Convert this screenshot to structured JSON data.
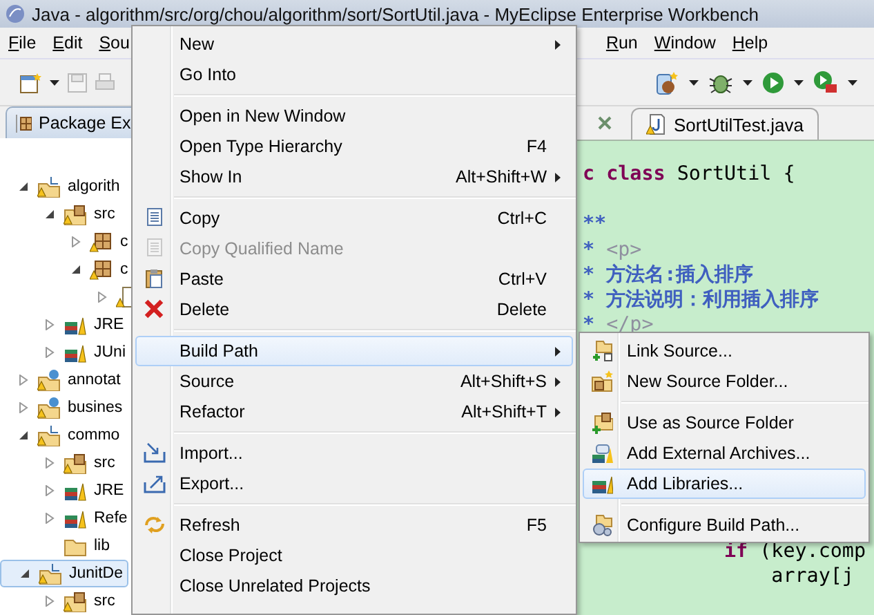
{
  "window": {
    "title": "Java - algorithm/src/org/chou/algorithm/sort/SortUtil.java - MyEclipse Enterprise Workbench"
  },
  "menubar": [
    "File",
    "Edit",
    "Sou",
    "Run",
    "Window",
    "Help"
  ],
  "explorer": {
    "title": "Package Ex",
    "tree": [
      {
        "label": "algorith",
        "kind": "project",
        "expanded": true,
        "selected": false,
        "children": [
          {
            "label": "src",
            "kind": "source-folder",
            "expanded": true,
            "selected": false,
            "children": [
              {
                "label": "c",
                "kind": "package",
                "expanded": false,
                "selected": false
              },
              {
                "label": "c",
                "kind": "package",
                "expanded": true,
                "selected": false,
                "children": [
                  {
                    "kind": "file",
                    "expanded": false,
                    "selected": false
                  }
                ]
              }
            ]
          },
          {
            "label": "JRE",
            "kind": "library",
            "expanded": false,
            "selected": false
          },
          {
            "label": "JUni",
            "kind": "library",
            "expanded": false,
            "selected": false
          }
        ]
      },
      {
        "label": "annotat",
        "kind": "web-project",
        "expanded": false,
        "selected": false
      },
      {
        "label": "busines",
        "kind": "web-project",
        "expanded": false,
        "selected": false
      },
      {
        "label": "commo",
        "kind": "project",
        "expanded": true,
        "selected": false,
        "children": [
          {
            "label": "src",
            "kind": "source-folder",
            "expanded": false,
            "selected": false
          },
          {
            "label": "JRE",
            "kind": "library",
            "expanded": false,
            "selected": false
          },
          {
            "label": "Refe",
            "kind": "library",
            "expanded": false,
            "selected": false
          },
          {
            "label": "lib",
            "kind": "folder",
            "selected": false
          }
        ]
      },
      {
        "label": "JunitDe",
        "kind": "project",
        "expanded": true,
        "selected": true,
        "children": [
          {
            "label": "src",
            "kind": "source-folder",
            "expanded": false,
            "selected": false
          }
        ]
      }
    ]
  },
  "editor": {
    "tabs": [
      {
        "label": "SortUtilTest.java",
        "selected": false
      }
    ],
    "lines": [
      [
        {
          "kind": "keyword",
          "text": "c class"
        },
        {
          "kind": "plain",
          "text": " SortUtil {"
        }
      ],
      [
        {
          "kind": "blank"
        }
      ],
      [
        {
          "kind": "javadoc",
          "text": "**"
        }
      ],
      [
        {
          "kind": "javadoc",
          "text": "* "
        },
        {
          "kind": "tag",
          "text": "<p>"
        }
      ],
      [
        {
          "kind": "javadoc",
          "text": "* 方法名:插入排序"
        }
      ],
      [
        {
          "kind": "javadoc",
          "text": "* 方法说明：利用插入排序"
        }
      ],
      [
        {
          "kind": "javadoc",
          "text": "* "
        },
        {
          "kind": "tag",
          "text": "</p>"
        }
      ],
      [
        {
          "kind": "blank"
        }
      ],
      [
        {
          "kind": "blank"
        }
      ],
      [
        {
          "kind": "blank"
        }
      ],
      [
        {
          "kind": "blank"
        }
      ],
      [
        {
          "kind": "blank"
        }
      ],
      [
        {
          "kind": "blank"
        }
      ],
      [
        {
          "kind": "blank"
        }
      ],
      [
        {
          "kind": "blank"
        }
      ],
      [
        {
          "kind": "keyword",
          "text": "            if"
        },
        {
          "kind": "plain",
          "text": " (key.comp"
        }
      ],
      [
        {
          "kind": "plain",
          "text": "                array[j"
        }
      ]
    ]
  },
  "context_menu": [
    {
      "kind": "item",
      "label": "New",
      "submenu": true,
      "disabled": false,
      "selected": false
    },
    {
      "kind": "item",
      "label": "Go Into",
      "submenu": false,
      "disabled": false,
      "selected": false
    },
    {
      "kind": "separator"
    },
    {
      "kind": "item",
      "label": "Open in New Window",
      "submenu": false,
      "disabled": false,
      "selected": false
    },
    {
      "kind": "item",
      "label": "Open Type Hierarchy",
      "shortcut": "F4",
      "submenu": false,
      "disabled": false,
      "selected": false
    },
    {
      "kind": "item",
      "label": "Show In",
      "shortcut": "Alt+Shift+W",
      "submenu": true,
      "disabled": false,
      "selected": false
    },
    {
      "kind": "separator"
    },
    {
      "kind": "item",
      "label": "Copy",
      "shortcut": "Ctrl+C",
      "submenu": false,
      "disabled": false,
      "selected": false
    },
    {
      "kind": "item",
      "label": "Copy Qualified Name",
      "submenu": false,
      "disabled": true,
      "selected": false
    },
    {
      "kind": "item",
      "label": "Paste",
      "shortcut": "Ctrl+V",
      "submenu": false,
      "disabled": false,
      "selected": false
    },
    {
      "kind": "item",
      "label": "Delete",
      "shortcut": "Delete",
      "submenu": false,
      "disabled": false,
      "selected": false
    },
    {
      "kind": "separator"
    },
    {
      "kind": "item",
      "label": "Build Path",
      "submenu": true,
      "disabled": false,
      "selected": true
    },
    {
      "kind": "item",
      "label": "Source",
      "shortcut": "Alt+Shift+S",
      "submenu": true,
      "disabled": false,
      "selected": false
    },
    {
      "kind": "item",
      "label": "Refactor",
      "shortcut": "Alt+Shift+T",
      "submenu": true,
      "disabled": false,
      "selected": false
    },
    {
      "kind": "separator"
    },
    {
      "kind": "item",
      "label": "Import...",
      "submenu": false,
      "disabled": false,
      "selected": false
    },
    {
      "kind": "item",
      "label": "Export...",
      "submenu": false,
      "disabled": false,
      "selected": false
    },
    {
      "kind": "separator"
    },
    {
      "kind": "item",
      "label": "Refresh",
      "shortcut": "F5",
      "submenu": false,
      "disabled": false,
      "selected": false
    },
    {
      "kind": "item",
      "label": "Close Project",
      "submenu": false,
      "disabled": false,
      "selected": false
    },
    {
      "kind": "item",
      "label": "Close Unrelated Projects",
      "submenu": false,
      "disabled": false,
      "selected": false
    }
  ],
  "submenu": [
    {
      "kind": "item",
      "label": "Link Source...",
      "disabled": false,
      "selected": false
    },
    {
      "kind": "item",
      "label": "New Source Folder...",
      "disabled": false,
      "selected": false
    },
    {
      "kind": "separator"
    },
    {
      "kind": "item",
      "label": "Use as Source Folder",
      "disabled": false,
      "selected": false
    },
    {
      "kind": "item",
      "label": "Add External Archives...",
      "disabled": false,
      "selected": false
    },
    {
      "kind": "item",
      "label": "Add Libraries...",
      "disabled": false,
      "selected": true
    },
    {
      "kind": "separator"
    },
    {
      "kind": "item",
      "label": "Configure Build Path...",
      "disabled": false,
      "selected": false
    }
  ]
}
